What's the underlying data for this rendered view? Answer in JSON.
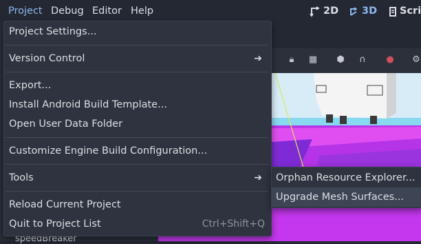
{
  "menubar": {
    "items": [
      "Project",
      "Debug",
      "Editor",
      "Help"
    ],
    "active": "Project",
    "right": {
      "view_2d": "2D",
      "view_3d": "3D",
      "script": "Scrip"
    }
  },
  "project_menu": {
    "items": [
      {
        "label": "Project Settings..."
      },
      {
        "label": "Version Control",
        "submenu": true
      },
      {
        "label": "Export..."
      },
      {
        "label": "Install Android Build Template..."
      },
      {
        "label": "Open User Data Folder"
      },
      {
        "label": "Customize Engine Build Configuration..."
      },
      {
        "label": "Tools",
        "submenu": true
      },
      {
        "label": "Reload Current Project"
      },
      {
        "label": "Quit to Project List",
        "shortcut": "Ctrl+Shift+Q"
      }
    ]
  },
  "tools_submenu": {
    "items": [
      {
        "label": "Orphan Resource Explorer..."
      },
      {
        "label": "Upgrade Mesh Surfaces..."
      }
    ],
    "hovered": "Upgrade Mesh Surfaces..."
  },
  "scene_tree": {
    "partial_item": "speedBreaker"
  },
  "colors": {
    "accent": "#8fb7f0",
    "menu_bg": "#2e333f",
    "editor_bg": "#232833",
    "floor_magenta": "#c437ee",
    "sky": "#d8ecf8"
  }
}
